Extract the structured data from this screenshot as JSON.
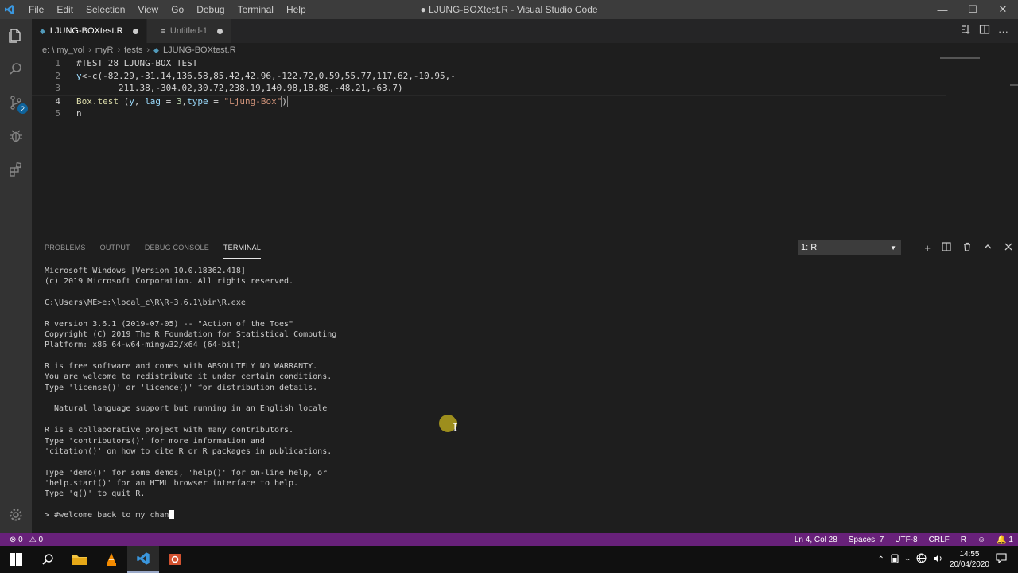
{
  "titlebar": {
    "menu": [
      "File",
      "Edit",
      "Selection",
      "View",
      "Go",
      "Debug",
      "Terminal",
      "Help"
    ],
    "title": "● LJUNG-BOXtest.R - Visual Studio Code",
    "min": "—",
    "max": "☐",
    "close": "✕"
  },
  "activity": {
    "badge": "2"
  },
  "tabs": [
    {
      "label": "LJUNG-BOXtest.R",
      "active": true
    },
    {
      "label": "Untitled-1",
      "active": false
    }
  ],
  "breadcrumb": [
    "e: \\ my_vol",
    "myR",
    "tests",
    "LJUNG-BOXtest.R"
  ],
  "editor": {
    "lines": [
      {
        "num": "1"
      },
      {
        "num": "2"
      },
      {
        "num": "3"
      },
      {
        "num": "4"
      },
      {
        "num": "5"
      }
    ],
    "line1": "#TEST 28 LJUNG-BOX TEST",
    "line2a": "y",
    "line2b": "<-c(-82.29,-31.14,136.58,85.42,42.96,-122.72,0.59,55.77,117.62,-10.95,-",
    "line3": "        211.38,-304.02,30.72,238.19,140.98,18.88,-48.21,-63.7)",
    "line4_fn": "Box.test",
    "line4_a": " (",
    "line4_y": "y",
    "line4_b": ", ",
    "line4_lag": "lag",
    "line4_c": " = ",
    "line4_3": "3",
    "line4_d": ",",
    "line4_type": "type",
    "line4_e": " = ",
    "line4_str": "\"Ljung-Box\"",
    "line4_f": ")",
    "line5": "n"
  },
  "panel": {
    "tabs": [
      "PROBLEMS",
      "OUTPUT",
      "DEBUG CONSOLE",
      "TERMINAL"
    ],
    "terminal_select": "1: R",
    "terminal_lines": [
      "Microsoft Windows [Version 10.0.18362.418]",
      "(c) 2019 Microsoft Corporation. All rights reserved.",
      "",
      "C:\\Users\\ME>e:\\local_c\\R\\R-3.6.1\\bin\\R.exe",
      "",
      "R version 3.6.1 (2019-07-05) -- \"Action of the Toes\"",
      "Copyright (C) 2019 The R Foundation for Statistical Computing",
      "Platform: x86_64-w64-mingw32/x64 (64-bit)",
      "",
      "R is free software and comes with ABSOLUTELY NO WARRANTY.",
      "You are welcome to redistribute it under certain conditions.",
      "Type 'license()' or 'licence()' for distribution details.",
      "",
      "  Natural language support but running in an English locale",
      "",
      "R is a collaborative project with many contributors.",
      "Type 'contributors()' for more information and",
      "'citation()' on how to cite R or R packages in publications.",
      "",
      "Type 'demo()' for some demos, 'help()' for on-line help, or",
      "'help.start()' for an HTML browser interface to help.",
      "Type 'q()' to quit R.",
      ""
    ],
    "prompt": "> #welcome back to my chan"
  },
  "status": {
    "errors": "⊗ 0",
    "warnings": "⚠ 0",
    "position": "Ln 4, Col 28",
    "spaces": "Spaces: 7",
    "encoding": "UTF-8",
    "eol": "CRLF",
    "language": "R",
    "bell": "🔔 1"
  },
  "taskbar": {
    "time": "14:55",
    "date": "20/04/2020"
  }
}
